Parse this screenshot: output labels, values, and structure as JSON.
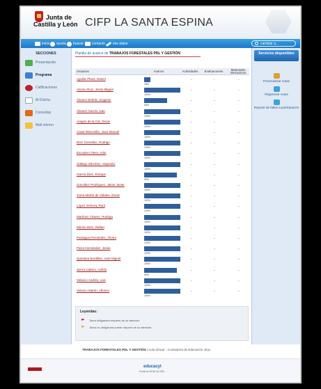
{
  "header": {
    "logo_line1": "Junta de",
    "logo_line2": "Castilla y León",
    "site_title": "CIFP LA SANTA ESPINA"
  },
  "navbar": {
    "items": [
      {
        "label": "inicio",
        "icon": "home-icon"
      },
      {
        "label": "ayuda",
        "icon": "help-icon"
      },
      {
        "label": "buscar",
        "icon": "search-icon"
      },
      {
        "label": "contacto",
        "icon": "mail-icon"
      },
      {
        "label": "mis datos",
        "icon": "pencil-icon"
      }
    ],
    "user_menu": "cambiar a..."
  },
  "sidebar": {
    "title": "SECCIONES",
    "items": [
      {
        "label": "Presentación",
        "color": "#4caf50"
      },
      {
        "label": "Programa",
        "color": "#3f7fcf",
        "active": true
      },
      {
        "label": "Calificaciones",
        "color": "#c0202a"
      },
      {
        "label": "Al Día/ría",
        "color": "#e9eef5"
      },
      {
        "label": "Consultas",
        "color": "#e06a1a"
      },
      {
        "label": "Mail interno",
        "color": "#f3c23b"
      }
    ]
  },
  "rightbar": {
    "title": "Servicios disponibles",
    "items": [
      {
        "label": "Previsualizar notas"
      },
      {
        "label": "Regenerar notas"
      },
      {
        "label": "Reporte de faltas a participación"
      }
    ]
  },
  "breadcrumb": {
    "prefix": "Planilla de avance de",
    "course": "TRABAJOS FORESTALES PDL Y GESTIÓN"
  },
  "table": {
    "headers": [
      "Usuarios",
      "Avance",
      "Actividades",
      "Evaluaciones",
      "Materiales interactivos"
    ],
    "rows": [
      {
        "name": "Aguilar Plaza, Daniel",
        "progress": 18,
        "pct_label": "18%"
      },
      {
        "name": "Alonso Ruiz, Jesús Miguel",
        "progress": 100,
        "pct_label": "100%"
      },
      {
        "name": "Álvarez Beltrán, Eugenio",
        "progress": 63,
        "pct_label": "63%"
      },
      {
        "name": "Álvarez García, Iván",
        "progress": 100,
        "pct_label": "100%"
      },
      {
        "name": "Aragón de la Cal, Óscar",
        "progress": 100,
        "pct_label": "100%"
      },
      {
        "name": "Casal Rebordillo, Juan Manuel",
        "progress": 100,
        "pct_label": "100%"
      },
      {
        "name": "Díez González, Rodrigo",
        "progress": 100,
        "pct_label": "100%"
      },
      {
        "name": "Escudero Otero, Iván",
        "progress": 100,
        "pct_label": "100%"
      },
      {
        "name": "Gallego Sánchez, Alejandro",
        "progress": 100,
        "pct_label": "100%"
      },
      {
        "name": "García Díez, Enrique",
        "progress": 90,
        "pct_label": "90%"
      },
      {
        "name": "González Rodríguez, Jaime Javier",
        "progress": 100,
        "pct_label": "100%"
      },
      {
        "name": "Jorna Martín de Vidales, Óscar",
        "progress": 100,
        "pct_label": "100%"
      },
      {
        "name": "López Ventura, Raúl",
        "progress": 100,
        "pct_label": "100%"
      },
      {
        "name": "Martínez Álvarez, Rodrigo",
        "progress": 100,
        "pct_label": "100%"
      },
      {
        "name": "Merino Díez, Rafael",
        "progress": 100,
        "pct_label": "100%"
      },
      {
        "name": "Paniagua Fernández, Álvaro",
        "progress": 100,
        "pct_label": "100%"
      },
      {
        "name": "Parra Hernández, Jesús",
        "progress": 100,
        "pct_label": "100%"
      },
      {
        "name": "Quintana Bordillas, José Miguel",
        "progress": 100,
        "pct_label": "100%"
      },
      {
        "name": "Sierra Cabero, Adrián",
        "progress": 90,
        "pct_label": "90%"
      },
      {
        "name": "Velasco Andrés, Luis",
        "progress": 100,
        "pct_label": "100%"
      },
      {
        "name": "Velasco Martín, Alfonso",
        "progress": 100,
        "pct_label": "100%"
      }
    ]
  },
  "legend": {
    "title": "Leyendas:",
    "items": [
      {
        "label": "Tarea obligatoria requiere de su atención",
        "color": "#d8262a"
      },
      {
        "label": "Tarea no obligatoria puede requerir de su atención",
        "color": "#f0a020"
      }
    ]
  },
  "footer": {
    "course": "TRABAJOS FORESTALES PDL Y GESTIÓN",
    "rest": "| Aula Virtual :: Consejería de Educación JCyL"
  },
  "bottom": {
    "brand": "educacyl",
    "brand_sub": "Portal de EDUCACIÓN"
  }
}
